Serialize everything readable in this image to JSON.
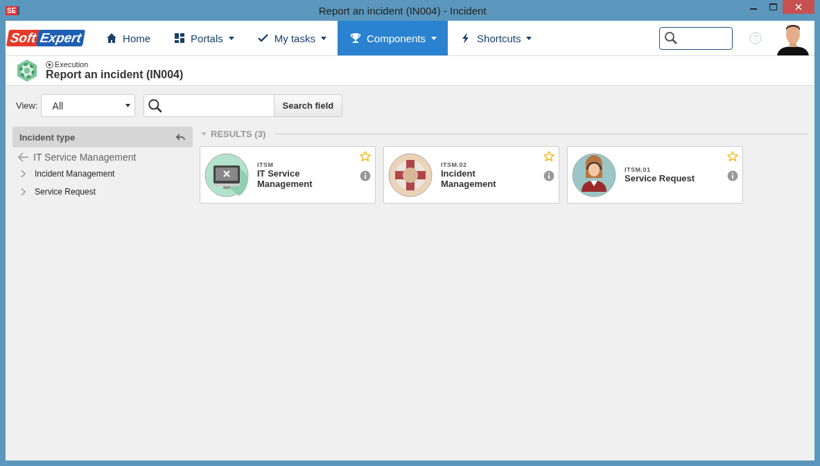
{
  "window": {
    "app_icon": "SE",
    "title": "Report an incident (IN004) - Incident"
  },
  "logo": {
    "part_1": "Soft",
    "part_2": "Expert"
  },
  "nav": [
    {
      "label": "Home",
      "selected": false,
      "menu": false
    },
    {
      "label": "Portals",
      "selected": false,
      "menu": true
    },
    {
      "label": "My tasks",
      "selected": false,
      "menu": true
    },
    {
      "label": "Components",
      "selected": true,
      "menu": true
    },
    {
      "label": "Shortcuts",
      "selected": false,
      "menu": true
    }
  ],
  "header": {
    "mode": "Execution",
    "title": "Report an incident (IN004)"
  },
  "filter": {
    "view_label": "View:",
    "view_value": "All",
    "search_button": "Search field"
  },
  "sidebar": {
    "title": "Incident type",
    "parent": {
      "label": "IT Service Management",
      "children": [
        {
          "label": "Incident Management"
        },
        {
          "label": "Service Request"
        }
      ]
    }
  },
  "results": {
    "title": "RESULTS (3)",
    "expanded": true,
    "cards": [
      {
        "code": "ITSM",
        "name": "IT Service Management",
        "favorite": false
      },
      {
        "code": "ITSM.02",
        "name": "Incident Management",
        "favorite": false
      },
      {
        "code": "ITSM.01",
        "name": "Service Request",
        "favorite": false
      }
    ]
  }
}
